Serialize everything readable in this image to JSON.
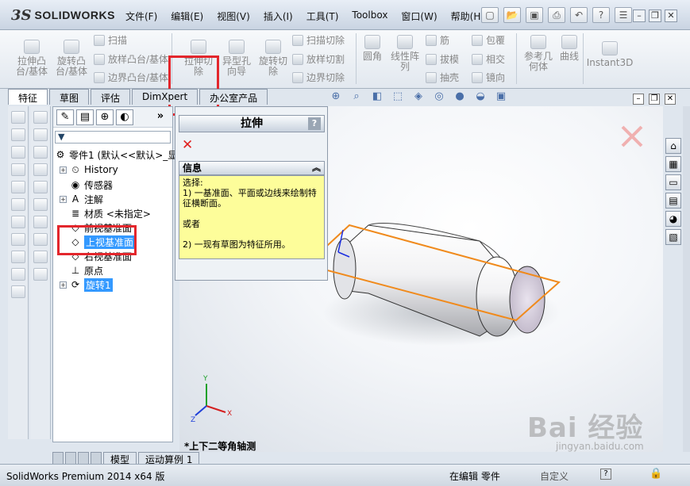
{
  "app": {
    "logo_mark": "3S",
    "logo_text": "SOLIDWORKS"
  },
  "menu": [
    "文件(F)",
    "编辑(E)",
    "视图(V)",
    "插入(I)",
    "工具(T)",
    "Toolbox",
    "窗口(W)",
    "帮助(H)"
  ],
  "ribbon": {
    "boss_extrude": "拉伸凸\n台/基体",
    "boss_revolve": "旋转凸\n台/基体",
    "sweep": "扫描",
    "loft": "放样凸台/基体",
    "boundary": "边界凸台/基体",
    "cut_extrude": "拉伸切\n除",
    "hole_wizard": "异型孔\n向导",
    "cut_revolve": "旋转切\n除",
    "swept_cut": "扫描切除",
    "lofted_cut": "放样切割",
    "boundary_cut": "边界切除",
    "fillet": "圆角",
    "linear_pattern": "线性阵\n列",
    "rib": "筋",
    "draft": "拔模",
    "shell": "抽壳",
    "wrap": "包覆",
    "intersect": "相交",
    "mirror": "镜向",
    "ref_geometry": "参考几\n何体",
    "curves": "曲线",
    "instant3d": "Instant3D"
  },
  "tabs": [
    "特征",
    "草图",
    "评估",
    "DimXpert",
    "办公室产品"
  ],
  "tree": {
    "filter_icon": "filter-icon",
    "part": "零件1 (默认<<默认>_显",
    "history": "History",
    "sensors": "传感器",
    "annotations": "注解",
    "material": "材质 <未指定>",
    "front_plane": "前视基准面",
    "top_plane": "上视基准面",
    "right_plane": "右视基准面",
    "origin": "原点",
    "revolve1": "旋转1"
  },
  "bottom_tabs": [
    "模型",
    "运动算例 1"
  ],
  "pm": {
    "title": "拉伸",
    "help": "?",
    "info_header": "信息",
    "info_lines": [
      "选择:",
      "1) 一基准面、平面或边线来绘制特征横断面。",
      "",
      "或者",
      "",
      "2) 一现有草图为特征所用。"
    ]
  },
  "view": {
    "name": "*上下二等角轴测"
  },
  "status": {
    "product": "SolidWorks Premium 2014 x64 版",
    "state": "在编辑 零件",
    "custom": "自定义"
  },
  "watermark": {
    "main": "Bai 经验",
    "sub": "jingyan.baidu.com"
  },
  "colors": {
    "highlight": "#3399ff",
    "redbox": "#e3262c",
    "plane": "#f08a1c",
    "info_bg": "#fdfd9a"
  }
}
